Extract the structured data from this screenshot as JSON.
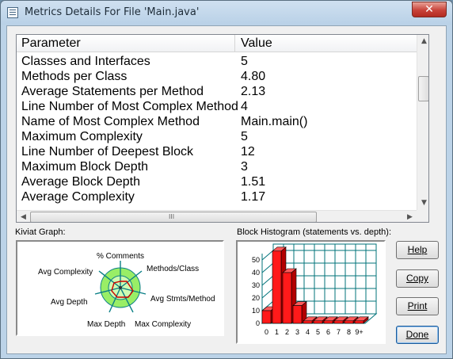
{
  "window": {
    "title": "Metrics Details For File 'Main.java'",
    "close_glyph": "✕"
  },
  "table": {
    "headers": {
      "parameter": "Parameter",
      "value": "Value"
    },
    "rows": [
      {
        "parameter": "Classes and Interfaces",
        "value": "5"
      },
      {
        "parameter": "Methods per Class",
        "value": "4.80"
      },
      {
        "parameter": "Average Statements per Method",
        "value": "2.13"
      },
      {
        "parameter": "Line Number of Most Complex Method",
        "value": "4"
      },
      {
        "parameter": "Name of Most Complex Method",
        "value": "Main.main()"
      },
      {
        "parameter": "Maximum Complexity",
        "value": "5"
      },
      {
        "parameter": "Line Number of Deepest Block",
        "value": "12"
      },
      {
        "parameter": "Maximum Block Depth",
        "value": "3"
      },
      {
        "parameter": "Average Block Depth",
        "value": "1.51"
      },
      {
        "parameter": "Average Complexity",
        "value": "1.17"
      }
    ],
    "scroll": {
      "up_glyph": "▲",
      "down_glyph": "▼",
      "left_glyph": "◀",
      "right_glyph": "▶",
      "grip_glyph": "III"
    }
  },
  "kiviat": {
    "label": "Kiviat Graph:",
    "axes": [
      "% Comments",
      "Methods/Class",
      "Avg Stmts/Method",
      "Max Complexity",
      "Max Depth",
      "Avg Depth",
      "Avg Complexity"
    ]
  },
  "histogram": {
    "label": "Block Histogram (statements vs. depth):"
  },
  "chart_data": {
    "type": "bar",
    "categories": [
      "0",
      "1",
      "2",
      "3",
      "4",
      "5",
      "6",
      "7",
      "8",
      "9+"
    ],
    "values": [
      10,
      57,
      40,
      14,
      2,
      2,
      2,
      2,
      2,
      2
    ],
    "ylim": [
      0,
      55
    ],
    "yticks": [
      0,
      10,
      20,
      30,
      40,
      50
    ],
    "title": "",
    "xlabel": "",
    "ylabel": ""
  },
  "buttons": {
    "help": "Help",
    "copy": "Copy",
    "print": "Print",
    "done": "Done"
  },
  "colors": {
    "bar": "#ff1a1a",
    "bar_side": "#b30000",
    "bar_top": "#ff5a5a",
    "grid": "#00737a",
    "kiviat_outer": "#99ee66",
    "kiviat_inner": "#cffbb2",
    "kiviat_axis": "#0a7f86",
    "kiviat_data": "#cc0000"
  }
}
